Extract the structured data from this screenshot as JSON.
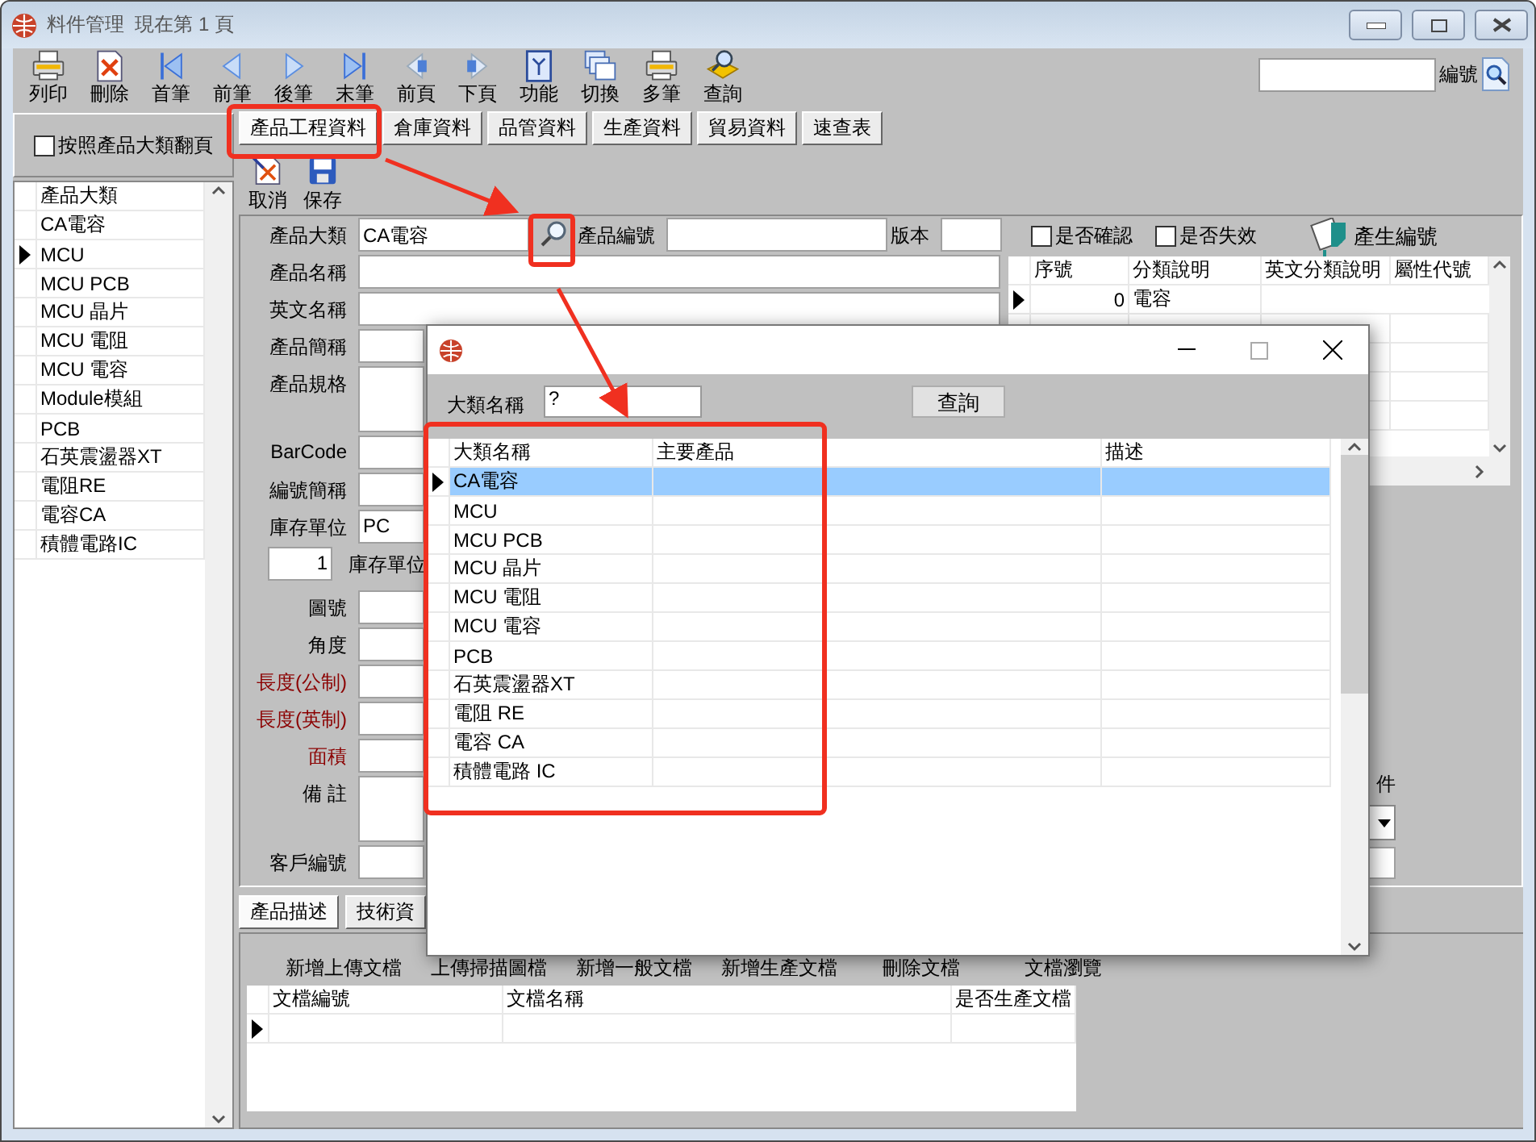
{
  "window": {
    "title": "料件管理  現在第 1 頁"
  },
  "toolbar": [
    {
      "label": "列印",
      "kind": "print"
    },
    {
      "label": "刪除",
      "kind": "delete"
    },
    {
      "label": "首筆",
      "kind": "first"
    },
    {
      "label": "前筆",
      "kind": "prev"
    },
    {
      "label": "後筆",
      "kind": "next"
    },
    {
      "label": "末筆",
      "kind": "last"
    },
    {
      "label": "前頁",
      "kind": "prevpage"
    },
    {
      "label": "下頁",
      "kind": "nextpage"
    },
    {
      "label": "功能",
      "kind": "function"
    },
    {
      "label": "切換",
      "kind": "switch"
    },
    {
      "label": "多筆",
      "kind": "print"
    },
    {
      "label": "查詢",
      "kind": "query"
    }
  ],
  "search": {
    "label": "編號"
  },
  "tabs": [
    {
      "label": "產品工程資料",
      "selected": true
    },
    {
      "label": "倉庫資料",
      "selected": false
    },
    {
      "label": "品管資料",
      "selected": false
    },
    {
      "label": "生產資料",
      "selected": false
    },
    {
      "label": "貿易資料",
      "selected": false
    },
    {
      "label": "速查表",
      "selected": false
    }
  ],
  "sidebar": {
    "checkbox": {
      "label": "按照產品大類翻頁",
      "checked": false
    },
    "header": "產品大類",
    "items": [
      {
        "label": "CA電容",
        "current": false
      },
      {
        "label": "MCU",
        "current": true
      },
      {
        "label": "MCU PCB",
        "current": false
      },
      {
        "label": "MCU 晶片",
        "current": false
      },
      {
        "label": "MCU 電阻",
        "current": false
      },
      {
        "label": "MCU 電容",
        "current": false
      },
      {
        "label": "Module模組",
        "current": false
      },
      {
        "label": "PCB",
        "current": false
      },
      {
        "label": "石英震盪器XT",
        "current": false
      },
      {
        "label": "電阻RE",
        "current": false
      },
      {
        "label": "電容CA",
        "current": false
      },
      {
        "label": "積體電路IC",
        "current": false
      }
    ]
  },
  "actions": [
    {
      "label": "取消",
      "kind": "cancel"
    },
    {
      "label": "保存",
      "kind": "save"
    }
  ],
  "form": {
    "category": {
      "label": "產品大類",
      "value": "CA電容"
    },
    "product_no": {
      "label": "產品編號"
    },
    "version": {
      "label": "版本"
    },
    "rows": [
      {
        "label": "產品名稱",
        "kind": "text",
        "emphasis": false
      },
      {
        "label": "英文名稱",
        "kind": "text",
        "emphasis": false
      },
      {
        "label": "產品簡稱",
        "kind": "text",
        "emphasis": false
      },
      {
        "label": "產品規格",
        "kind": "area",
        "emphasis": false
      },
      {
        "label": "BarCode",
        "kind": "text",
        "emphasis": false
      },
      {
        "label": "編號簡稱",
        "kind": "text",
        "emphasis": false
      },
      {
        "label": "庫存單位",
        "kind": "text",
        "value": "PC",
        "emphasis": false
      },
      {
        "kind": "unit",
        "quantity": "1",
        "caption": "庫存單位",
        "emphasis": false
      },
      {
        "label": "圖號",
        "kind": "text",
        "emphasis": false
      },
      {
        "label": "角度",
        "kind": "text",
        "emphasis": false
      },
      {
        "label": "長度(公制)",
        "kind": "text",
        "emphasis": true
      },
      {
        "label": "長度(英制)",
        "kind": "text",
        "emphasis": true
      },
      {
        "label": "面積",
        "kind": "text",
        "emphasis": true
      },
      {
        "label": "備 註",
        "kind": "area",
        "emphasis": false
      },
      {
        "label": "客戶編號",
        "kind": "text",
        "emphasis": false
      }
    ]
  },
  "flags": [
    {
      "label": "是否確認",
      "checked": false
    },
    {
      "label": "是否失效",
      "checked": false
    }
  ],
  "generate_button": {
    "label": "產生編號"
  },
  "class_grid": {
    "columns": [
      "序號",
      "分類說明",
      "英文分類說明",
      "屬性代號"
    ],
    "rows": [
      {
        "cells": [
          "0",
          "電容"
        ],
        "current": true
      }
    ]
  },
  "partial_label": "件",
  "detail_tabs": [
    {
      "label": "產品描述",
      "selected": true
    },
    {
      "label": "技術資",
      "selected": false
    }
  ],
  "doc_actions": [
    "新增上傳文檔",
    "上傳掃描圖檔",
    "新增一般文檔",
    "新增生產文檔",
    "刪除文檔",
    "文檔瀏覽"
  ],
  "doc_grid": {
    "columns": [
      "文檔編號",
      "文檔名稱",
      "是否生產文檔"
    ],
    "rows": [
      {
        "current": true
      }
    ]
  },
  "dialog": {
    "search_label": "大類名稱",
    "search_value": "?",
    "query_button": "查詢",
    "columns": [
      "大類名稱",
      "主要產品",
      "描述"
    ],
    "rows": [
      {
        "cells": [
          "CA電容"
        ],
        "selected": true
      },
      {
        "cells": [
          "MCU"
        ],
        "selected": false
      },
      {
        "cells": [
          "MCU PCB"
        ],
        "selected": false
      },
      {
        "cells": [
          "MCU 晶片"
        ],
        "selected": false
      },
      {
        "cells": [
          "MCU 電阻"
        ],
        "selected": false
      },
      {
        "cells": [
          "MCU 電容"
        ],
        "selected": false
      },
      {
        "cells": [
          "PCB"
        ],
        "selected": false
      },
      {
        "cells": [
          "石英震盪器XT"
        ],
        "selected": false
      },
      {
        "cells": [
          "電阻 RE"
        ],
        "selected": false
      },
      {
        "cells": [
          "電容 CA"
        ],
        "selected": false
      },
      {
        "cells": [
          "積體電路 IC"
        ],
        "selected": false
      }
    ]
  }
}
